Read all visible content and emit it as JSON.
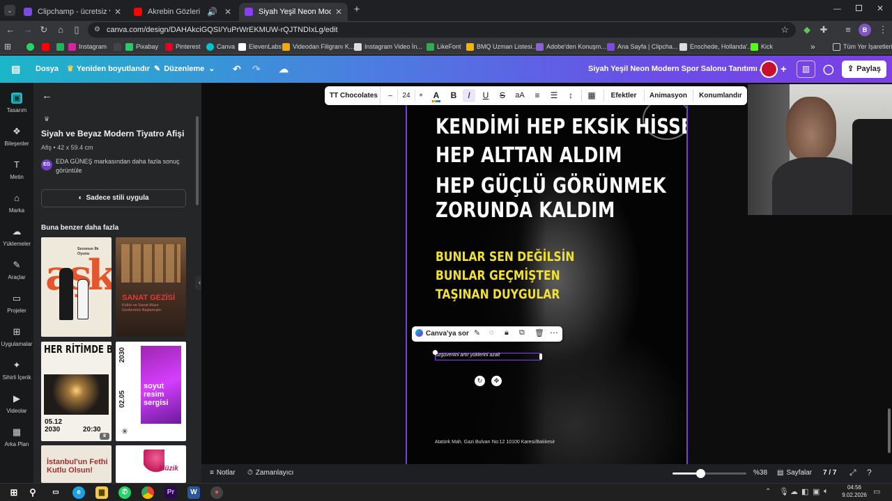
{
  "browser": {
    "tabs": [
      {
        "title": "Clipchamp - ücretsiz video düz",
        "active": false,
        "color": "#7b4ae2"
      },
      {
        "title": "Akrebin Gözleri - YouTube",
        "active": false,
        "color": "#ff0000"
      },
      {
        "title": "Siyah Yeşil Neon Modern Spor",
        "active": true,
        "color": "#8b3dff"
      }
    ],
    "new_tab_symbol": "+",
    "url": "canva.com/design/DAHAkciGQSI/YuPrWrEKMUW-rQJTNDIxLg/edit",
    "bookmarks": [
      {
        "label": "",
        "icon": "whatsapp-icon",
        "color": "#25d366"
      },
      {
        "label": "",
        "icon": "youtube-icon",
        "color": "#ff0000"
      },
      {
        "label": "",
        "icon": "evernote-icon",
        "color": "#22b35e"
      },
      {
        "label": "Instagram",
        "icon": "instagram-icon",
        "color": "#d6249f"
      },
      {
        "label": "",
        "icon": "p-icon",
        "color": "#444444"
      },
      {
        "label": "Pixabay",
        "icon": "pixabay-icon",
        "color": "#2ec66d"
      },
      {
        "label": "Pinterest",
        "icon": "pinterest-icon",
        "color": "#e60023"
      },
      {
        "label": "Canva",
        "icon": "canva-icon",
        "color": "#00c4cc"
      },
      {
        "label": "ElevenLabs",
        "icon": "elevenlabs-icon",
        "color": "#ffffff"
      },
      {
        "label": "Videodan Filigranı K...",
        "icon": "filigran-icon",
        "color": "#f2a900"
      },
      {
        "label": "Instagram Video İn...",
        "icon": "download-icon",
        "color": "#dddddd"
      },
      {
        "label": "LikeFont",
        "icon": "likefont-icon",
        "color": "#34a853"
      },
      {
        "label": "BMQ Uzman Listesi...",
        "icon": "bmq-icon",
        "color": "#f4b400"
      },
      {
        "label": "Adobe'den Konuşm...",
        "icon": "adobe-icon",
        "color": "#8a63d2"
      },
      {
        "label": "Ana Sayfa | Clipcha...",
        "icon": "clipchamp-icon",
        "color": "#7b4ae2"
      },
      {
        "label": "Enschede, Hollanda'...",
        "icon": "camera-icon",
        "color": "#dddddd"
      },
      {
        "label": "Kick",
        "icon": "kick-icon",
        "color": "#53fc18"
      }
    ],
    "all_bookmarks_label": "Tüm Yer İşaretleri",
    "more_bookmarks_symbol": "»"
  },
  "canva_header": {
    "file_label": "Dosya",
    "resize_label": "Yeniden boyutlandır",
    "edit_label": "Düzenleme",
    "design_title": "Siyah Yeşil Neon Modern Spor Salonu Tanıtımı Afiş",
    "share_label": "Paylaş",
    "avatar_color": "#c8102e"
  },
  "rail": [
    {
      "label": "Tasarım",
      "icon": "design-icon"
    },
    {
      "label": "Bileşenler",
      "icon": "elements-icon"
    },
    {
      "label": "Metin",
      "icon": "text-icon"
    },
    {
      "label": "Marka",
      "icon": "brand-icon"
    },
    {
      "label": "Yüklemeler",
      "icon": "upload-icon"
    },
    {
      "label": "Araçlar",
      "icon": "tools-icon"
    },
    {
      "label": "Projeler",
      "icon": "projects-icon"
    },
    {
      "label": "Uygulamalar",
      "icon": "apps-icon"
    },
    {
      "label": "Sihirli İçerik",
      "icon": "magic-icon"
    },
    {
      "label": "Videolar",
      "icon": "videos-icon"
    },
    {
      "label": "Arka Plan",
      "icon": "background-icon"
    }
  ],
  "panel": {
    "template_title": "Siyah ve Beyaz Modern Tiyatro Afişi",
    "template_meta": "Afiş • 42 x 59.4 cm",
    "brand_initials": "EG",
    "brand_text": "EDA GÜNEŞ markasından daha fazla sonuç görüntüle",
    "apply_style_label": "Sadece stili uygula",
    "similar_heading": "Buna benzer daha fazla",
    "thumbs": [
      {
        "text1": "Sezonun İlk Oyunu",
        "text2": "aşk",
        "bg": "#efe9dc"
      },
      {
        "text1": "SANAT GEZİSİ",
        "text2": "Kültür ve Sanat Müze Gezilerimiz Başlamıştır.",
        "bg": "#3b2a22"
      },
      {
        "text1": "HER RİTİMDE BİR DÜNYA",
        "text2": "05.12 2030",
        "text3": "20:30",
        "bg": "#f4f1ea"
      },
      {
        "text1": "soyut resim sergisi",
        "text2": "2030",
        "text3": "02.05",
        "bg": "#ffffff"
      },
      {
        "text1": "İstanbul'un Fethi Kutlu Olsun!",
        "bg": "#ece7da"
      },
      {
        "text1": "Müzik",
        "bg": "#ffffff"
      }
    ]
  },
  "toolbar": {
    "font": "TT Chocolates",
    "minus": "–",
    "size": "24",
    "plus": "+",
    "case_label": "aA",
    "effects_label": "Efektler",
    "animate_label": "Animasyon",
    "position_label": "Konumlandır"
  },
  "poster": {
    "lines_white": [
      "KENDİMİ HEP EKSİK HİSSETTİM",
      "HEP ALTTAN ALDIM",
      "HEP GÜÇLÜ GÖRÜNMEK",
      "ZORUNDA KALDIM"
    ],
    "lines_yellow": [
      "BUNLAR SEN DEĞİLSİN",
      "BUNLAR GEÇMİŞTEN",
      "TAŞINAN DUYGULAR"
    ],
    "selected_text": "özgüvenini artır yüklerini azalt",
    "address": "Atatürk Mah. Gazi Bulvarı No:12 10100 Karesi/Balıkesir"
  },
  "context_bar": {
    "ask_label": "Canva'ya sor"
  },
  "bottom_bar": {
    "notes_label": "Notlar",
    "timer_label": "Zamanlayıcı",
    "zoom_percent": 38,
    "zoom_label": "%38",
    "pages_label": "Sayfalar",
    "page_count": "7 / 7"
  },
  "taskbar": {
    "time": "04:56",
    "date": "9.02.2026"
  }
}
